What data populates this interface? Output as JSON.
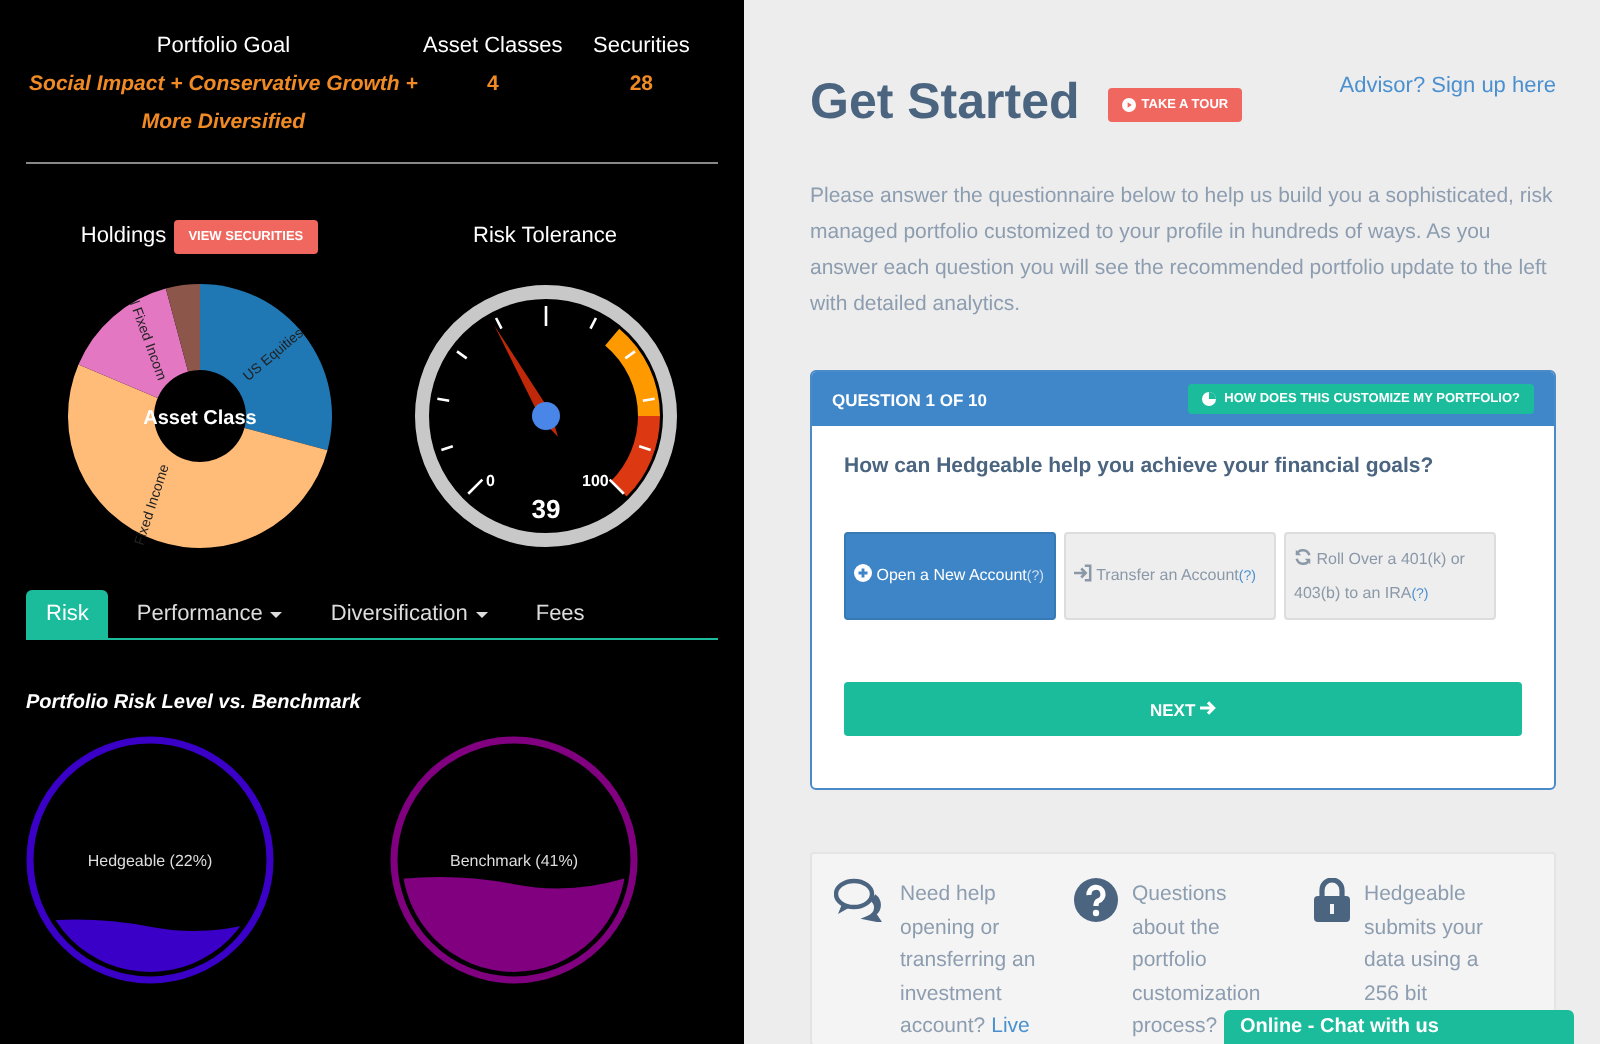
{
  "stats": [
    {
      "label": "Portfolio Goal",
      "value": "Social Impact + Conservative Growth + More Diversified",
      "kind": "goal"
    },
    {
      "label": "Asset Classes",
      "value": "4",
      "kind": "count"
    },
    {
      "label": "Securities",
      "value": "28",
      "kind": "count"
    }
  ],
  "holdings": {
    "title": "Holdings",
    "button": "VIEW SECURITIES",
    "center_label": "Asset Class",
    "segments": [
      {
        "label": "US Equities",
        "color": "#1f77b4"
      },
      {
        "label": "Fixed Income",
        "color": "#ffbb78"
      },
      {
        "label": "l Fixed Incom",
        "color": "#e377c2"
      },
      {
        "color": "#8c564b"
      }
    ]
  },
  "risk_tolerance": {
    "title": "Risk Tolerance",
    "min": "0",
    "max": "100",
    "reading": "39"
  },
  "tabs": [
    {
      "label": "Risk",
      "selected": true,
      "dropdown": false
    },
    {
      "label": "Performance",
      "selected": false,
      "dropdown": true
    },
    {
      "label": "Diversification",
      "selected": false,
      "dropdown": true
    },
    {
      "label": "Fees",
      "selected": false,
      "dropdown": false
    }
  ],
  "risk_chart": {
    "title": "Portfolio Risk Level vs. Benchmark",
    "gauges": [
      {
        "label": "Hedgeable (22%)",
        "color": "#3a00c8"
      },
      {
        "label": "Benchmark (41%)",
        "color": "#800080"
      }
    ]
  },
  "header": {
    "title": "Get Started",
    "tour_button": "TAKE A TOUR",
    "advisor_link": "Advisor? Sign up here"
  },
  "intro": "Please answer the questionnaire below to help us build you a sophisticated, risk managed portfolio customized to your profile in hundreds of ways. As you answer each question you will see the recommended portfolio update to the left with detailed analytics.",
  "question": {
    "counter": "QUESTION 1 OF 10",
    "help_button": "HOW DOES THIS CUSTOMIZE MY PORTFOLIO?",
    "text": "How can Hedgeable help you achieve your financial goals?",
    "options": [
      {
        "label": "Open a New Account",
        "hint": "(?)",
        "kind": "plus",
        "selected": true
      },
      {
        "label": "Transfer an Account",
        "hint": "(?)",
        "kind": "transfer",
        "selected": false
      },
      {
        "label": "Roll Over a 401(k) or 403(b) to an IRA",
        "hint": "(?)",
        "kind": "refresh",
        "selected": false
      }
    ],
    "next_button": "NEXT"
  },
  "info": [
    {
      "kind": "chat",
      "lines": [
        "Need help",
        "opening or",
        "transferring an",
        "investment",
        "account?"
      ],
      "link": "Live"
    },
    {
      "kind": "question",
      "lines": [
        "Questions",
        "about the",
        "portfolio",
        "customization",
        "process?"
      ]
    },
    {
      "kind": "lock",
      "lines": [
        "Hedgeable",
        "submits your",
        "data using a",
        "256 bit"
      ]
    }
  ],
  "chat_bar": "Online - Chat with us"
}
